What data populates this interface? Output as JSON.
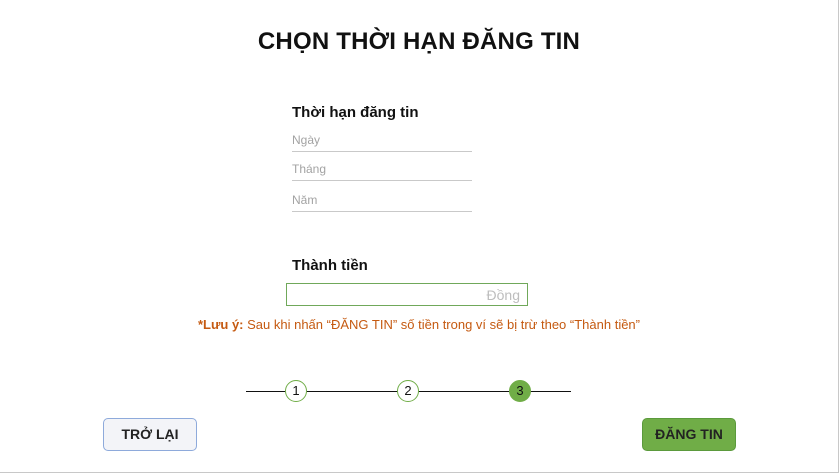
{
  "title": "CHỌN THỜI HẠN ĐĂNG TIN",
  "duration": {
    "label": "Thời hạn đăng tin",
    "day_placeholder": "Ngày",
    "month_placeholder": "Tháng",
    "year_placeholder": "Năm"
  },
  "total": {
    "label": "Thành tiền",
    "unit": "Đồng",
    "value": ""
  },
  "note": {
    "prefix": "*Lưu ý:",
    "text": " Sau khi nhấn “ĐĂNG TIN” số tiền trong ví sẽ bị trừ theo “Thành tiền”"
  },
  "steps": [
    {
      "label": "1",
      "state": "done"
    },
    {
      "label": "2",
      "state": "done"
    },
    {
      "label": "3",
      "state": "active"
    }
  ],
  "buttons": {
    "back": "TRỞ LẠI",
    "post": "ĐĂNG TIN"
  },
  "colors": {
    "accent_green": "#70ad47",
    "note_orange": "#c55a11",
    "back_border": "#8eaadb"
  }
}
